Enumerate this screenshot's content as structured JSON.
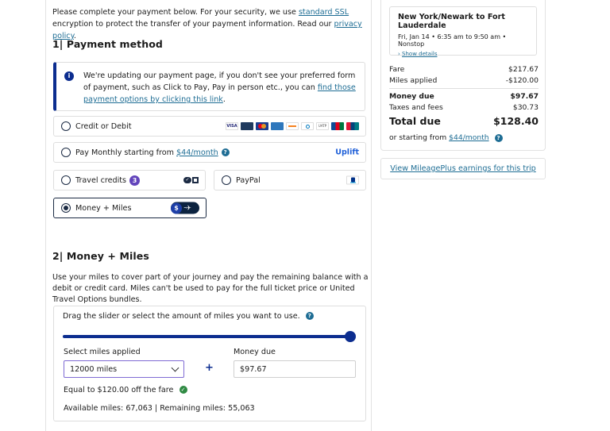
{
  "intro": {
    "text_before": "Please complete your payment below. For your security, we use ",
    "ssl_link": "standard SSL",
    "text_middle": " encryption to protect the transfer of your payment information. Read our ",
    "privacy_link": "privacy policy",
    "text_end": "."
  },
  "section1": {
    "title": "1| Payment method",
    "notice": {
      "text": "We're updating our payment page, if you don't see your preferred form of payment, such as Click to Pay, Pay in person etc., you can ",
      "link": "find those payment options by clicking this link",
      "end": "."
    },
    "methods": {
      "credit": {
        "label": "Credit or Debit",
        "selected": false,
        "logos": [
          "visa",
          "dinersclub",
          "mastercard",
          "amex",
          "discover",
          "jcb-diners",
          "uatp",
          "jcb",
          "unionpay"
        ]
      },
      "monthly": {
        "label": "Pay Monthly starting from ",
        "link": "$44/month",
        "brand": "Uplift",
        "selected": false
      },
      "travel_credits": {
        "label": "Travel credits",
        "count": "3",
        "selected": false
      },
      "paypal": {
        "label": "PayPal",
        "selected": false
      },
      "money_miles": {
        "label": "Money + Miles",
        "selected": true
      }
    }
  },
  "section2": {
    "title": "2| Money + Miles",
    "description": "Use your miles to cover part of your journey and pay the remaining balance with a debit or credit card. Miles can't be used to pay for the full ticket price or United Travel Options bundles.",
    "slider_label": "Drag the slider or select the amount of miles you want to use.",
    "slider_value_fraction": 1.0,
    "miles_label": "Select miles applied",
    "miles_value": "12000 miles",
    "plus": "+",
    "money_label": "Money due",
    "money_value": "$97.67",
    "equal_text": "Equal to $120.00 off the fare",
    "miles_summary": "Available miles: 67,063 | Remaining miles: 55,063"
  },
  "sidebar": {
    "trip": {
      "title": "New York/Newark to Fort Lauderdale",
      "details": "Fri, Jan 14 • 6:35 am to 9:50 am • Nonstop",
      "show_details": "Show details"
    },
    "rows": [
      {
        "label": "Fare",
        "value": "$217.67"
      },
      {
        "label": "Miles applied",
        "value": "-$120.00"
      },
      {
        "label": "Money due",
        "value": "$97.67"
      },
      {
        "label": "Taxes and fees",
        "value": "$30.73"
      },
      {
        "label": "Total due",
        "value": "$128.40"
      }
    ],
    "starting_text": "or starting from ",
    "starting_link": "$44/month",
    "earnings_link": "View MileagePlus earnings for this trip"
  }
}
